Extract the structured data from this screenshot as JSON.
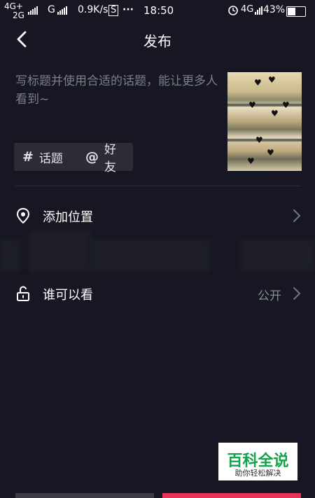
{
  "status_bar": {
    "net1": "4G+",
    "net2": "2G",
    "g": "G",
    "speed": "0.9K/s",
    "dots": "···",
    "time": "18:50",
    "net3": "4G",
    "battery": "43%"
  },
  "header": {
    "title": "发布"
  },
  "post": {
    "placeholder": "写标题并使用合适的话题，能让更多人看到~",
    "chips": [
      {
        "icon": "#",
        "label": "话题"
      },
      {
        "icon": "@",
        "label": "好友"
      }
    ]
  },
  "options": {
    "location": {
      "label": "添加位置"
    },
    "visibility": {
      "label": "谁可以看",
      "value": "公开"
    }
  },
  "watermark": {
    "line1": "百科全说",
    "line2": "助你轻松解决"
  }
}
